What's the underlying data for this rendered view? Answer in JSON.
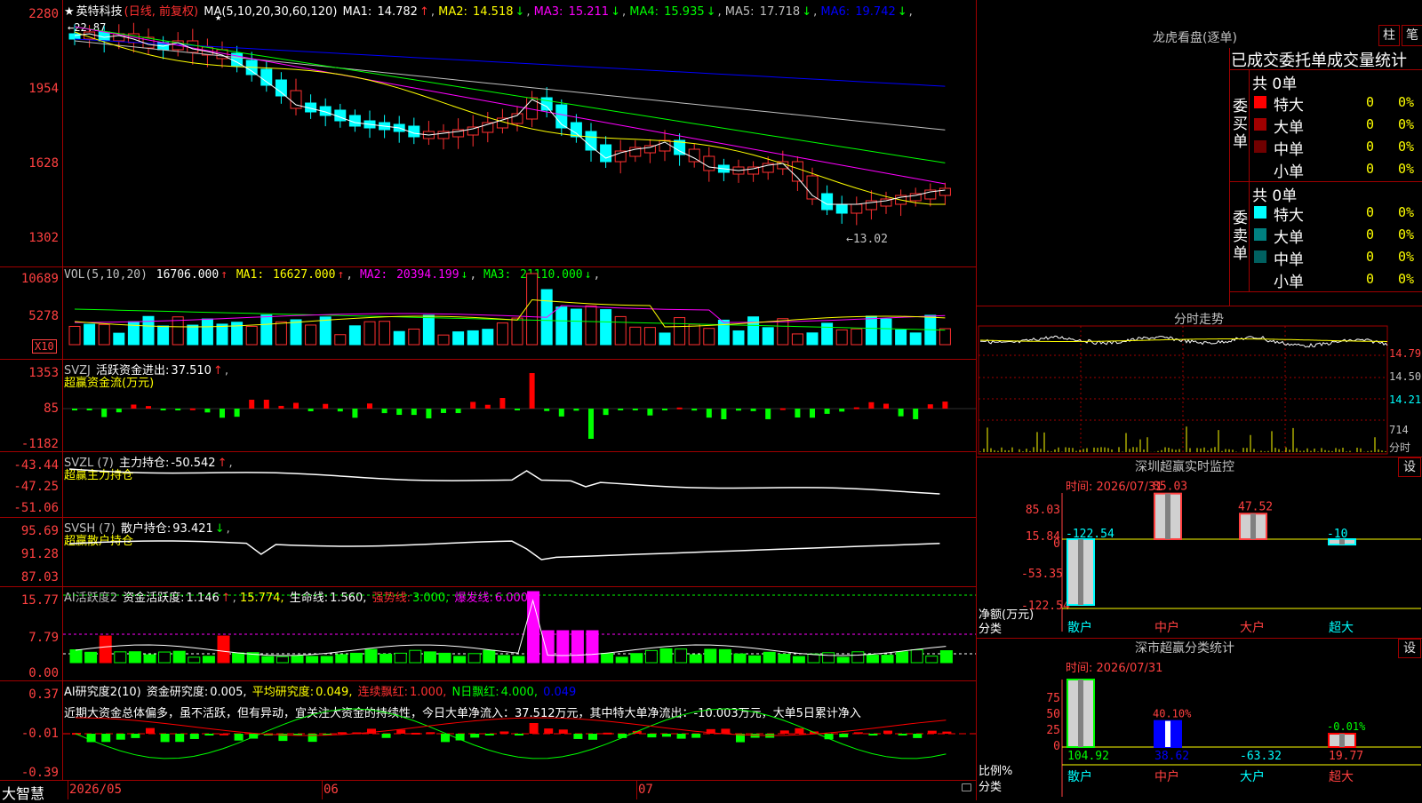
{
  "stock": {
    "mark": "★",
    "name": "英特科技",
    "period": "(日线, 前复权)"
  },
  "price_panel": {
    "ma_label": "MA(5,10,20,30,60,120)",
    "ma": [
      {
        "label": "MA1:",
        "value": "14.782",
        "arrow": "↑",
        "color": "#ffffff"
      },
      {
        "label": "MA2:",
        "value": "14.518",
        "arrow": "↓",
        "color": "#ffff00"
      },
      {
        "label": "MA3:",
        "value": "15.211",
        "arrow": "↓",
        "color": "#ff00ff"
      },
      {
        "label": "MA4:",
        "value": "15.935",
        "arrow": "↓",
        "color": "#00ff00"
      },
      {
        "label": "MA5:",
        "value": "17.718",
        "arrow": "↓",
        "color": "#c0c0c0"
      },
      {
        "label": "MA6:",
        "value": "19.742",
        "arrow": "↓",
        "color": "#0000ff"
      }
    ],
    "y_labels": [
      "2280",
      "1954",
      "1628",
      "1302"
    ],
    "high_annot": "←22.87",
    "low_annot": "←13.02",
    "highlights": [
      "★"
    ]
  },
  "vol_panel": {
    "label": "VOL(5,10,20)",
    "value": "16706.000",
    "arrow": "↑",
    "ma": [
      {
        "label": "MA1:",
        "value": "16627.000",
        "arrow": "↑",
        "color": "#ffff00"
      },
      {
        "label": "MA2:",
        "value": "20394.199",
        "arrow": "↓",
        "color": "#ff00ff"
      },
      {
        "label": "MA3:",
        "value": "21110.000",
        "arrow": "↓",
        "color": "#00ff00"
      }
    ],
    "y_labels": [
      "10689",
      "5278"
    ],
    "unit": "X10"
  },
  "svzj_panel": {
    "name": "SVZJ",
    "line_label": "活跃资金进出:",
    "value": "37.510",
    "arrow": "↑",
    "subtitle": "超赢资金流(万元)",
    "y_labels": [
      "1353",
      "85",
      "-1182"
    ]
  },
  "svzl_panel": {
    "name": "SVZL (7)",
    "line_label": "主力持仓:",
    "value": "-50.542",
    "arrow": "↑",
    "subtitle": "超赢主力持仓",
    "y_labels": [
      "-43.44",
      "-47.25",
      "-51.06"
    ]
  },
  "svsh_panel": {
    "name": "SVSH (7)",
    "line_label": "散户持仓:",
    "value": "93.421",
    "arrow": "↓",
    "subtitle": "超赢散户持仓",
    "y_labels": [
      "95.69",
      "91.28",
      "87.03"
    ]
  },
  "ai_active_panel": {
    "name": "AI活跃度2",
    "l1": "资金活跃度:",
    "v1": "1.146",
    "a1": "↑",
    "v2": "15.774,",
    "l3": "生命线:",
    "v3": "1.560,",
    "l4": "强势线:",
    "v4": "3.000,",
    "l5": "爆发线:",
    "v5": "6.000,",
    "y_labels": [
      "15.77",
      "7.79",
      "0.00"
    ]
  },
  "ai_research_panel": {
    "name": "AI研究度2(10)",
    "l1": "资金研究度:",
    "v1": "0.005,",
    "l2": "平均研究度:",
    "v2": "0.049,",
    "l3": "连续飘红:",
    "v3": "1.000,",
    "l4": "N日飘红:",
    "v4": "4.000,",
    "v5": "0.049",
    "commentary": "近期大资金总体偏多，虽不活跃，但有异动，宜关注大资金的持续性，今日大单净流入：37.512万元，其中特大单净流出：-10.003万元，大单5日累计净入",
    "y_labels": [
      "0.37",
      "-0.01",
      "-0.39"
    ]
  },
  "x_axis": {
    "logo": "大智慧",
    "labels": [
      "2026/05",
      "06",
      "07"
    ]
  },
  "dragon": {
    "title": "龙虎看盘(逐单)",
    "btn1": "柱",
    "btn2": "笔",
    "subtitle": "已成交委托单成交量统计",
    "buy_side": "委买单",
    "sell_side": "委卖单",
    "buy_total": "共 0单",
    "sell_total": "共 0单",
    "buy_rows": [
      {
        "label": "特大",
        "value": "0",
        "pct": "0%",
        "color": "#ff0000"
      },
      {
        "label": "大单",
        "value": "0",
        "pct": "0%",
        "color": "#a00000"
      },
      {
        "label": "中单",
        "value": "0",
        "pct": "0%",
        "color": "#700000"
      },
      {
        "label": "小单",
        "value": "0",
        "pct": "0%",
        "color": "#000000"
      }
    ],
    "sell_rows": [
      {
        "label": "特大",
        "value": "0",
        "pct": "0%",
        "color": "#00ffff"
      },
      {
        "label": "大单",
        "value": "0",
        "pct": "0%",
        "color": "#008080"
      },
      {
        "label": "中单",
        "value": "0",
        "pct": "0%",
        "color": "#006060"
      },
      {
        "label": "小单",
        "value": "0",
        "pct": "0%",
        "color": "#000000"
      }
    ]
  },
  "intraday": {
    "title": "分时走势",
    "prices": [
      "14.79",
      "14.50",
      "14.21"
    ],
    "vol_label": "714",
    "vol_unit": "分时"
  },
  "monitor": {
    "title": "深圳超赢实时监控",
    "btn": "设",
    "time": "时间: 2026/07/31",
    "y_labels": [
      "85.03",
      "15.84",
      "0",
      "-53.35",
      "-122.54"
    ],
    "axis_unit": "净额(万元)",
    "cat_label": "分类",
    "chart_data": {
      "type": "bar",
      "categories": [
        "散户",
        "中户",
        "大户",
        "超大"
      ],
      "values": [
        -122.54,
        85.03,
        47.52,
        -10
      ],
      "value_labels": [
        "-122.54",
        "85.03",
        "47.52",
        "-10"
      ],
      "ylim": [
        -122.54,
        85.03
      ]
    }
  },
  "stats": {
    "title": "深市超赢分类统计",
    "btn": "设",
    "time": "时间: 2026/07/31",
    "y_labels": [
      "75",
      "50",
      "25",
      "0"
    ],
    "axis_unit": "比例%",
    "cat_label": "分类",
    "chart_data": {
      "type": "bar",
      "categories": [
        "散户",
        "中户",
        "大户",
        "超大"
      ],
      "values": [
        104.92,
        38.62,
        -63.32,
        19.77
      ],
      "top_labels": [
        "",
        "40.10%",
        "",
        "-0.01%"
      ],
      "ylim": [
        0,
        100
      ]
    }
  }
}
